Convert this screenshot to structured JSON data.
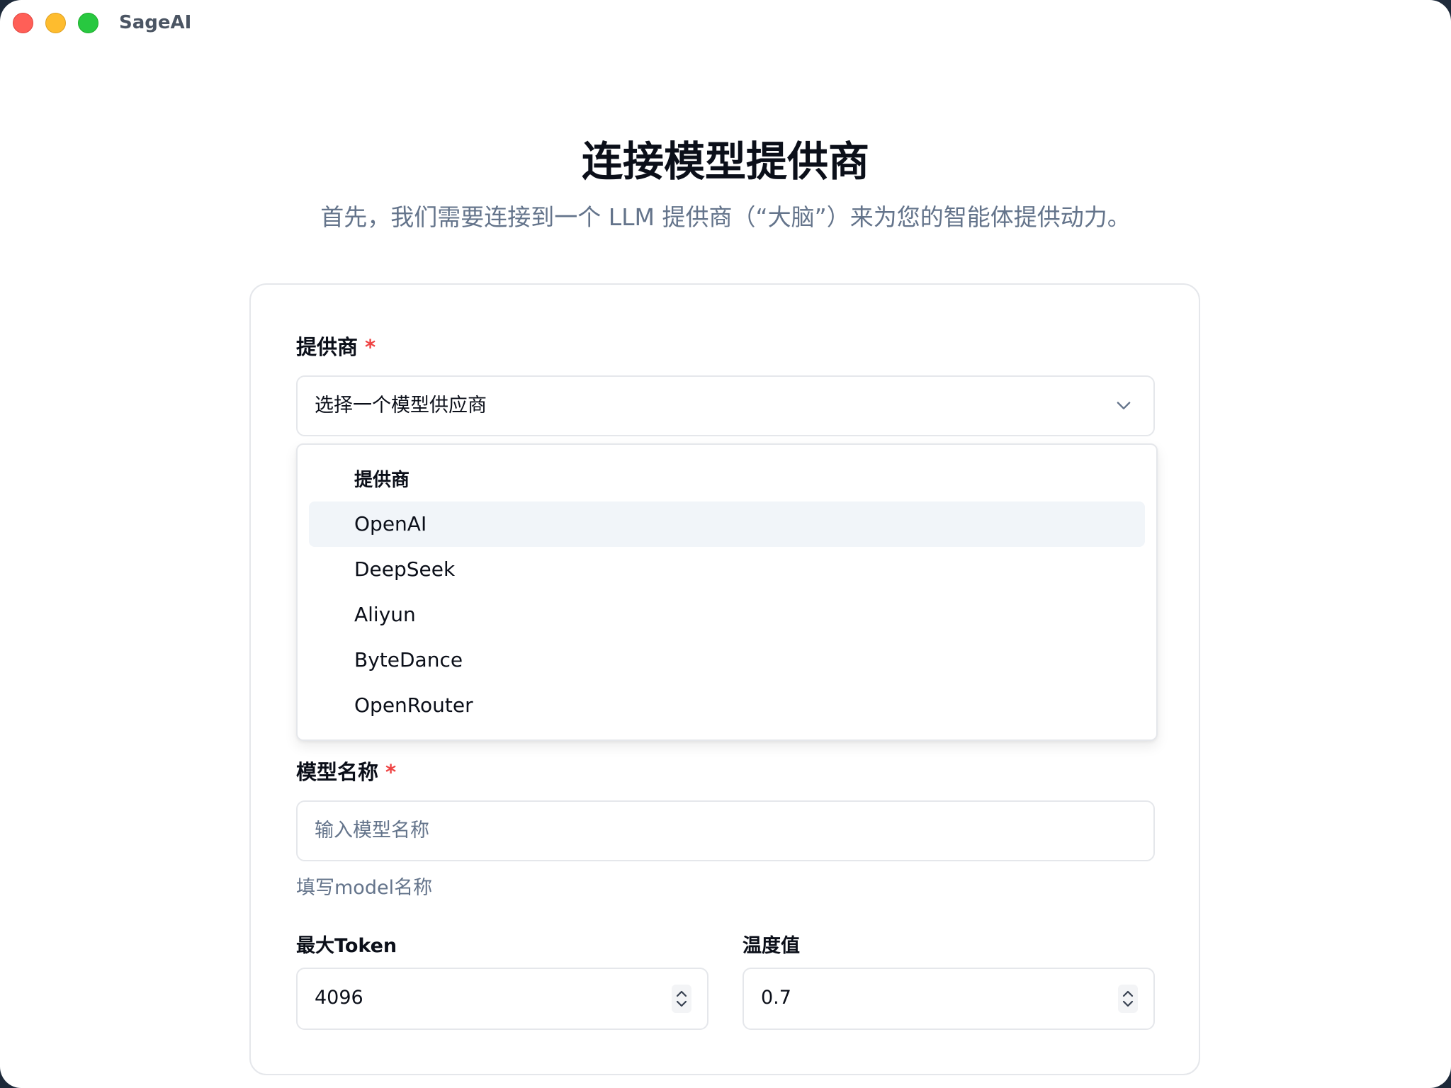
{
  "window": {
    "app_title": "SageAI"
  },
  "header": {
    "title": "连接模型提供商",
    "subtitle": "首先，我们需要连接到一个 LLM 提供商（“大脑”）来为您的智能体提供动力。"
  },
  "form": {
    "provider": {
      "label": "提供商",
      "required_mark": "*",
      "placeholder": "选择一个模型供应商"
    },
    "provider_dropdown": {
      "group_label": "提供商",
      "options": [
        "OpenAI",
        "DeepSeek",
        "Aliyun",
        "ByteDance",
        "OpenRouter"
      ],
      "highlighted": "OpenAI"
    },
    "model_name": {
      "label": "模型名称",
      "required_mark": "*",
      "placeholder": "输入模型名称",
      "hint": "填写model名称"
    },
    "max_token": {
      "label": "最大Token",
      "value": "4096"
    },
    "temperature": {
      "label": "温度值",
      "value": "0.7"
    }
  },
  "icons": {
    "chevron": "chevron-down-icon",
    "spinner": "stepper-arrows-icon"
  },
  "colors": {
    "required": "#ef4444",
    "muted_text": "#64748b",
    "highlight_bg": "#f1f5f9",
    "border": "#e5e7eb"
  }
}
